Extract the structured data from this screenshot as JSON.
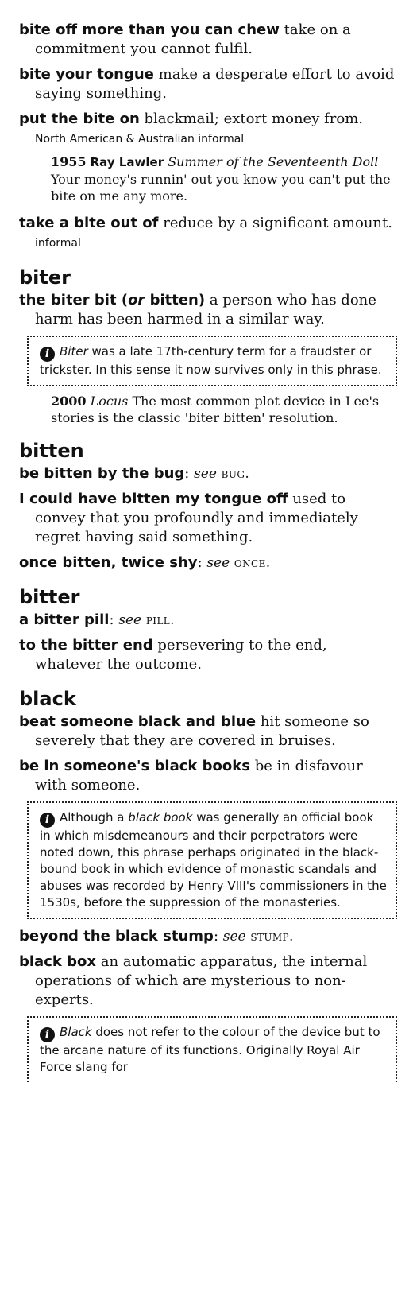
{
  "entries": {
    "bite_off": {
      "phrase": "bite off more than you can chew",
      "def": "take on a commitment you cannot fulfil."
    },
    "bite_tongue": {
      "phrase": "bite your tongue",
      "def": "make a desperate effort to avoid saying something."
    },
    "put_bite": {
      "phrase": "put the bite on",
      "def": "blackmail; extort money from.",
      "label": "North American & Australian informal",
      "quote": {
        "year": "1955",
        "author": "Ray Lawler",
        "title": "Summer of the Seventeenth Doll",
        "text": "Your money's runnin' out you know you can't put the bite on me any more."
      }
    },
    "take_bite": {
      "phrase": "take a bite out of",
      "def": "reduce by a significant amount.",
      "label": "informal"
    }
  },
  "biter": {
    "headword": "biter",
    "biter_bit": {
      "phrase_a": "the biter bit (",
      "or": "or",
      "phrase_b": " bitten)",
      "def": "a person who has done harm has been harmed in a similar way."
    },
    "note": {
      "term": "Biter",
      "text": " was a late 17th-century term for a fraudster or trickster. In this sense it now survives only in this phrase."
    },
    "quote": {
      "year": "2000",
      "title": "Locus",
      "text": "The most common plot device in Lee's stories is the classic 'biter bitten' resolution."
    }
  },
  "bitten": {
    "headword": "bitten",
    "bug": {
      "phrase": "be bitten by the bug",
      "see": "see",
      "ref": "bug."
    },
    "tongue_off": {
      "phrase": "I could have bitten my tongue off",
      "def": "used to convey that you profoundly and immediately regret having said something."
    },
    "once": {
      "phrase": "once bitten, twice shy",
      "see": "see",
      "ref": "once."
    }
  },
  "bitter": {
    "headword": "bitter",
    "pill": {
      "phrase": "a bitter pill",
      "see": "see",
      "ref": "pill."
    },
    "end": {
      "phrase": "to the bitter end",
      "def": "persevering to the end, whatever the outcome."
    }
  },
  "black": {
    "headword": "black",
    "black_blue": {
      "phrase": "beat someone black and blue",
      "def": "hit someone so severely that they are covered in bruises."
    },
    "black_books": {
      "phrase": "be in someone's black books",
      "def": "be in disfavour with someone."
    },
    "note1": {
      "lead": "Although a ",
      "term": "black book",
      "text": " was generally an official book in which misdemeanours and their perpetrators were noted down, this phrase perhaps originated in the black-bound book in which evidence of monastic scandals and abuses was recorded by Henry VIII's commissioners in the 1530s, before the suppression of the monasteries."
    },
    "stump": {
      "phrase": "beyond the black stump",
      "see": "see",
      "ref": "stump."
    },
    "black_box": {
      "phrase": "black box",
      "def": "an automatic apparatus, the internal operations of which are mysterious to non-experts."
    },
    "note2": {
      "term": "Black",
      "text": " does not refer to the colour of the device but to the arcane nature of its functions. Originally Royal Air Force slang for"
    }
  }
}
